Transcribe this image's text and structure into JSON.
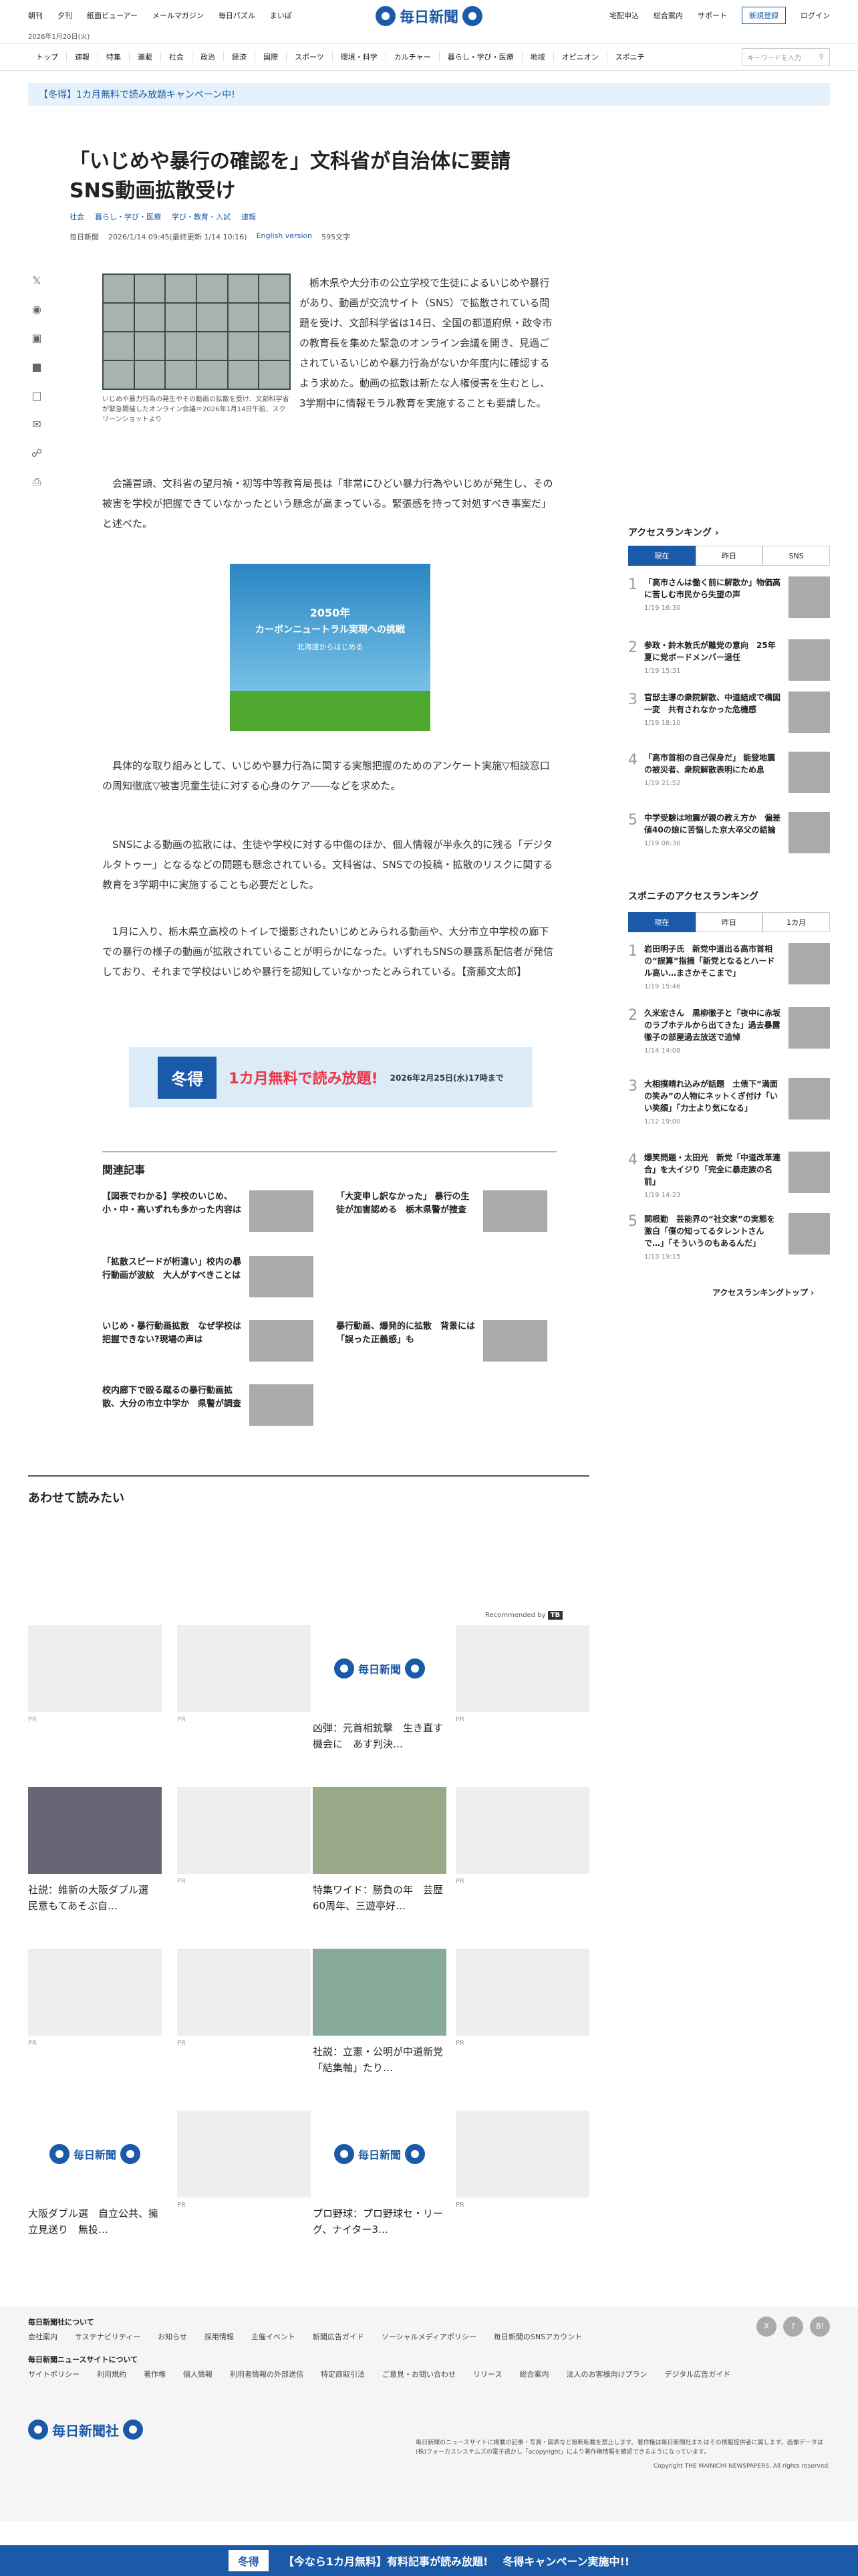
{
  "header": {
    "links_left": [
      "朝刊",
      "夕刊",
      "紙面ビューアー",
      "メールマガジン",
      "毎日パズル",
      "まいぽ"
    ],
    "logo": "毎日新聞",
    "links_right": [
      "宅配申込",
      "総合案内",
      "サポート"
    ],
    "register": "新規登録",
    "login": "ログイン",
    "date": "2026年1月20日(火)"
  },
  "nav": {
    "items": [
      "トップ",
      "速報",
      "特集",
      "連載",
      "社会",
      "政治",
      "経済",
      "国際",
      "スポーツ",
      "環境・科学",
      "カルチャー",
      "暮らし・学び・医療",
      "地域",
      "オピニオン",
      "スポニチ"
    ],
    "search_placeholder": "キーワードを入力"
  },
  "banner": "【冬得】1カ月無料で読み放題キャンペーン中!",
  "article": {
    "title": "「いじめや暴行の確認を」文科省が自治体に要請　SNS動画拡散受け",
    "tags": [
      "社会",
      "暮らし・学び・医療",
      "学び・教育・入試",
      "速報"
    ],
    "author": "毎日新聞",
    "datetime": "2026/1/14 09:45(最終更新 1/14 10:16)",
    "english": "English version",
    "chars": "595文字",
    "caption": "いじめや暴力行為の発生やその動画の拡散を受け、文部科学省が緊急開催したオンライン会議＝2026年1月14日午前、スクリーンショットより",
    "p1": "栃木県や大分市の公立学校で生徒によるいじめや暴行があり、動画が交流サイト（SNS）で拡散されている問題を受け、文部科学省は14日、全国の都道府県・政令市の教育長を集めた緊急のオンライン会議を開き、見過ごされているいじめや暴力行為がないか年度内に確認するよう求めた。動画の拡散は新たな人権侵害を生むとし、3学期中に情報モラル教育を実施することも要請した。",
    "p2": "会議冒頭、文科省の望月禎・初等中等教育局長は「非常にひどい暴力行為やいじめが発生し、その被害を学校が把握できていなかったという懸念が高まっている。緊張感を持って対処すべき事案だ」と述べた。",
    "p3": "具体的な取り組みとして、いじめや暴力行為に関する実態把握のためのアンケート実施▽相談窓口の周知徹底▽被害児童生徒に対する心身のケア――などを求めた。",
    "p4": "SNSによる動画の拡散には、生徒や学校に対する中傷のほか、個人情報が半永久的に残る「デジタルタトゥー」となるなどの問題も懸念されている。文科省は、SNSでの投稿・拡散のリスクに関する教育を3学期中に実施することも必要だとした。",
    "p5": "1月に入り、栃木県立高校のトイレで撮影されたいじめとみられる動画や、大分市立中学校の廊下での暴行の様子の動画が拡散されていることが明らかになった。いずれもSNSの暴露系配信者が発信しており、それまで学校はいじめや暴行を認知していなかったとみられている。【斎藤文太郎】"
  },
  "ad1": {
    "line1": "2050年",
    "line2": "カーボンニュートラル実現への挑戦",
    "line3": "北海道からはじめる"
  },
  "ad2": {
    "a": "冬得",
    "b": "1カ月無料で読み放題!",
    "c": "2026年2月25日(水)17時まで"
  },
  "related": {
    "heading": "関連記事",
    "items": [
      "【図表でわかる】学校のいじめ、小・中・高いずれも多かった内容は",
      "「大変申し訳なかった」 暴行の生徒が加害認める　栃木県警が捜査",
      "「拡散スピードが桁違い」校内の暴行動画が波紋　大人がすべきことは",
      "いじめ・暴行動画拡散　なぜ学校は把握できない?現場の声は",
      "暴行動画、爆発的に拡散　背景には「誤った正義感」も",
      "校内廊下で殴る蹴るの暴行動画拡散、大分の市立中学か　県警が調査"
    ]
  },
  "awase": "あわせて読みたい",
  "recommended": "Recommended by",
  "cards": [
    {
      "t": "",
      "pr": "PR"
    },
    {
      "t": "",
      "pr": "PR"
    },
    {
      "t": "凶弾：元首相銃撃　生き直す機会に　あす判決…",
      "pr": ""
    },
    {
      "t": "",
      "pr": "PR"
    },
    {
      "t": "社説：維新の大阪ダブル選　民意もてあそぶ自…",
      "pr": ""
    },
    {
      "t": "",
      "pr": "PR"
    },
    {
      "t": "特集ワイド：勝負の年　芸歴60周年、三遊亭好…",
      "pr": ""
    },
    {
      "t": "",
      "pr": "PR"
    },
    {
      "t": "",
      "pr": "PR"
    },
    {
      "t": "",
      "pr": "PR"
    },
    {
      "t": "社説：立憲・公明が中道新党　「結集軸」たり…",
      "pr": ""
    },
    {
      "t": "",
      "pr": "PR"
    },
    {
      "t": "大阪ダブル選　自立公共、擁立見送り　無投…",
      "pr": ""
    },
    {
      "t": "",
      "pr": "PR"
    },
    {
      "t": "プロ野球：プロ野球セ・リーグ、ナイター3…",
      "pr": ""
    },
    {
      "t": "",
      "pr": "PR"
    }
  ],
  "ranking": {
    "heading": "アクセスランキング",
    "tabs": [
      "現在",
      "昨日",
      "SNS"
    ],
    "items": [
      {
        "n": "1",
        "t": "「高市さんは働く前に解散か」物価高に苦しむ市民から失望の声",
        "tm": "1/19 16:30"
      },
      {
        "n": "2",
        "t": "参政・鈴木敦氏が離党の意向　25年夏に党ボードメンバー退任",
        "tm": "1/19 15:31"
      },
      {
        "n": "3",
        "t": "官邸主導の衆院解散、中道結成で構図一変　共有されなかった危機感",
        "tm": "1/19 18:10"
      },
      {
        "n": "4",
        "t": "「高市首相の自己保身だ」 能登地震の被災者、衆院解散表明にため息",
        "tm": "1/19 21:52"
      },
      {
        "n": "5",
        "t": "中学受験は地震が親の教え方か　偏差値40の娘に苦悩した京大卒父の結論",
        "tm": "1/19 06:30"
      }
    ]
  },
  "sponichi": {
    "heading": "スポニチのアクセスランキング",
    "tabs": [
      "現在",
      "昨日",
      "1カ月"
    ],
    "items": [
      {
        "n": "1",
        "t": "岩田明子氏　新党中道出る高市首相の“誤算”指摘「新党となるとハードル高い…まさかそこまで」",
        "tm": "1/19 15:46"
      },
      {
        "n": "2",
        "t": "久米宏さん　黒柳徹子と「夜中に赤坂のラブホテルから出てきた」過去暴露　徹子の部屋過去放送で追悼",
        "tm": "1/14 14:08"
      },
      {
        "n": "3",
        "t": "大相撲晴れ込みが話題　土俵下“満面の笑み”の人物にネットくぎ付け「いい笑顔」「力士より気になる」",
        "tm": "1/12 19:00"
      },
      {
        "n": "4",
        "t": "爆笑問題・太田光　新党「中道改革連合」を大イジり「完全に暴走族の名前」",
        "tm": "1/19 14:23"
      },
      {
        "n": "5",
        "t": "関根勤　芸能界の“社交家”の実態を激白「僕の知ってるタレントさんで…」「そういうのもあるんだ」",
        "tm": "1/13 19:15"
      }
    ],
    "top_link": "アクセスランキングトップ"
  },
  "footer": {
    "about": "毎日新聞社について",
    "row1": [
      "会社案内",
      "サステナビリティー",
      "お知らせ",
      "採用情報",
      "主催イベント",
      "新聞広告ガイド",
      "ソーシャルメディアポリシー",
      "毎日新聞のSNSアカウント"
    ],
    "about2": "毎日新聞ニュースサイトについて",
    "row2": [
      "サイトポリシー",
      "利用規約",
      "著作権",
      "個人情報",
      "利用者情報の外部送信",
      "特定商取引法",
      "ご意見・お問い合わせ",
      "リリース",
      "総合案内",
      "法人のお客様向けプラン",
      "デジタル広告ガイド"
    ],
    "company": "毎日新聞社",
    "copyright": "毎日新聞のニュースサイトに掲載の記事・写真・図表など無断転載を禁止します。著作権は毎日新聞社またはその情報提供者に属します。画像データは(株)フォーカスシステムズの電子透かし「acopyright」により著作権情報を確認できるようになっています。",
    "copy2": "Copyright THE MAINICHI NEWSPAPERS. All rights reserved.",
    "sns": [
      "X",
      "f",
      "B!"
    ]
  },
  "bottom": {
    "a": "冬得",
    "b": "【今なら1カ月無料】有料記事が読み放題!",
    "c": "冬得キャンペーン実施中!!"
  }
}
